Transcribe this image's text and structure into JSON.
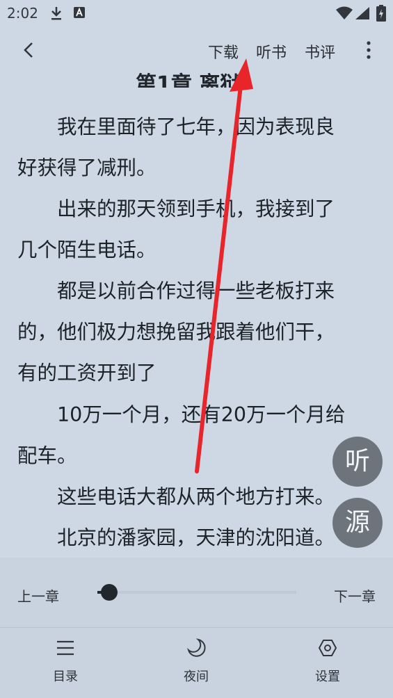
{
  "status_bar": {
    "time": "2:02"
  },
  "top_bar": {
    "download": "下载",
    "listen": "听书",
    "review": "书评"
  },
  "chapter": {
    "title": "第1章 离狱",
    "paragraphs": [
      "　　我在里面待了七年，因为表现良",
      "好获得了减刑。",
      "　　出来的那天领到手机，我接到了",
      "几个陌生电话。",
      "　　都是以前合作过得一些老板打来",
      "的，他们极力想挽留我跟着他们干，",
      "有的工资开到了",
      "　　10万一个月，还有20万一个月给",
      "配车。",
      "　　这些电话大都从两个地方打来。",
      "　　北京的潘家园，天津的沈阳道。"
    ]
  },
  "fabs": {
    "listen": "听",
    "source": "源"
  },
  "progress": {
    "prev": "上一章",
    "next": "下一章",
    "value": 0.06
  },
  "bottom_nav": {
    "catalog": "目录",
    "night": "夜间",
    "settings": "设置"
  },
  "colors": {
    "background": "#cdd8e4",
    "fab": "#6d747c",
    "annotation_arrow": "#e8252b"
  }
}
